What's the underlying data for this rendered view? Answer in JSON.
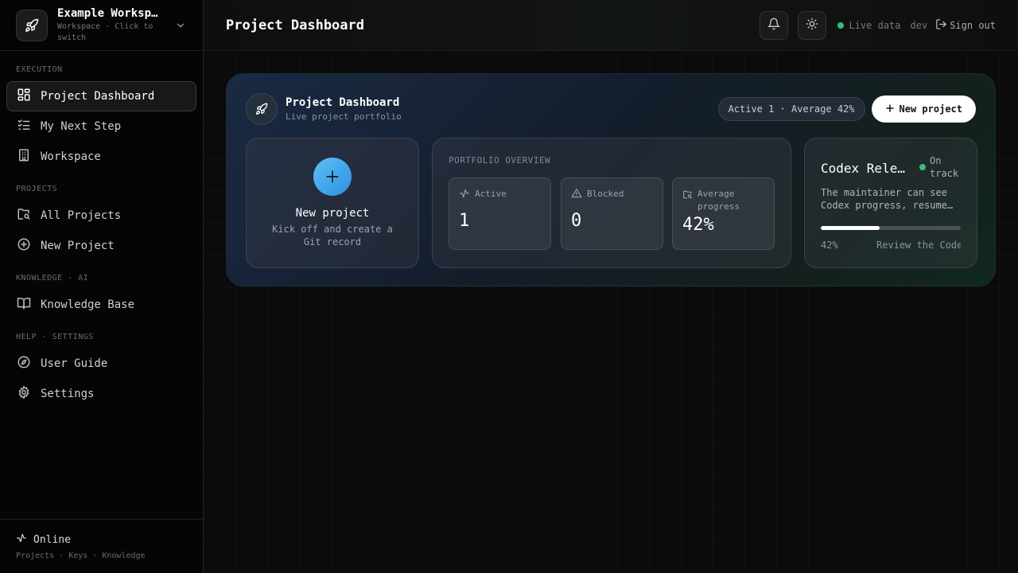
{
  "workspace": {
    "name": "Example Worksp…",
    "subtitle": "Workspace · Click to switch"
  },
  "nav": {
    "sections": [
      {
        "label": "EXECUTION",
        "items": [
          {
            "label": "Project Dashboard",
            "icon": "dashboard-icon",
            "active": true
          },
          {
            "label": "My Next Step",
            "icon": "checklist-icon"
          },
          {
            "label": "Workspace",
            "icon": "building-icon"
          }
        ]
      },
      {
        "label": "PROJECTS",
        "items": [
          {
            "label": "All Projects",
            "icon": "folder-search-icon"
          },
          {
            "label": "New Project",
            "icon": "plus-circle-icon"
          }
        ]
      },
      {
        "label": "KNOWLEDGE · AI",
        "items": [
          {
            "label": "Knowledge Base",
            "icon": "book-icon"
          }
        ]
      },
      {
        "label": "HELP · SETTINGS",
        "items": [
          {
            "label": "User Guide",
            "icon": "compass-icon"
          },
          {
            "label": "Settings",
            "icon": "gear-icon"
          }
        ]
      }
    ]
  },
  "footer": {
    "status": "Online",
    "sub": "Projects · Keys · Knowledge"
  },
  "topbar": {
    "title": "Project Dashboard",
    "live_label": "Live data",
    "env": "dev",
    "signout": "Sign out"
  },
  "hero": {
    "title": "Project Dashboard",
    "subtitle": "Live project portfolio",
    "summary": "Active 1 · Average 42%",
    "new_button": "New project"
  },
  "new_card": {
    "title": "New project",
    "subtitle": "Kick off and create a Git record"
  },
  "overview": {
    "label": "PORTFOLIO OVERVIEW",
    "stats": [
      {
        "label": "Active",
        "value": "1",
        "icon": "activity-icon"
      },
      {
        "label": "Blocked",
        "value": "0",
        "icon": "warning-icon"
      },
      {
        "label": "Average progress",
        "value": "42%",
        "icon": "folder-search-icon"
      }
    ]
  },
  "project": {
    "name": "Codex Release",
    "status": "On track",
    "description": "The maintainer can see Codex progress, resume…",
    "progress": 0.42,
    "progress_label": "42%",
    "next_step": "Review the Codex"
  },
  "colors": {
    "accent_green": "#34c07a",
    "accent_blue": "#3fa7ee"
  }
}
